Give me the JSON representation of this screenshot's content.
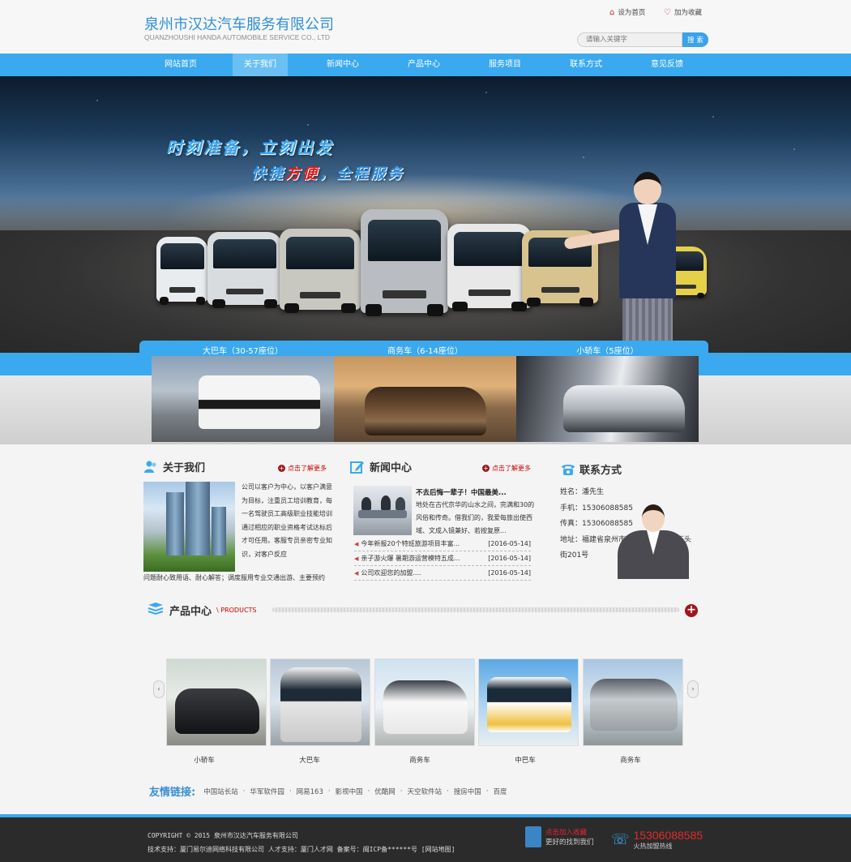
{
  "header": {
    "logo_cn": "泉州市汉达汽车服务有限公司",
    "logo_en": "QUANZHOUSHI HANDA AUTOMOBILE SERVICE CO., LTD",
    "set_home": "设为首页",
    "add_fav": "加为收藏",
    "search_placeholder": "请输入关键字",
    "search_button": "搜 索"
  },
  "nav": {
    "items": [
      "网站首页",
      "关于我们",
      "新闻中心",
      "产品中心",
      "服务项目",
      "联系方式",
      "意见反馈"
    ],
    "active": "关于我们"
  },
  "banner": {
    "slogan1": "时刻准备，立刻出发",
    "slogan2_a": "快捷",
    "slogan2_red": "方便",
    "slogan2_b": "，全程服务"
  },
  "categories": [
    "大巴车（30-57座位）",
    "商务车（6-14座位）",
    "小轿车（5座位）"
  ],
  "about": {
    "title": "关于我们",
    "more": "点击了解更多",
    "text": "公司以客户为中心，以客户满意为目标，注重员工培训教育，每一名驾驶员工高级职业技能培训通过相应的职业资格考试达标后才可任用。客服专员亲密专业知识，对客户反应",
    "text2": "问题耐心致用语、耐心解答；调度服用专业交通出游、主要预约"
  },
  "news": {
    "title": "新闻中心",
    "more": "点击了解更多",
    "headline": "不去后悔一辈子！中国最美...",
    "desc": "地处在古代京华的山水之间，完满和30的风俗和传奇。借我们的，我爱每旅出使西域、文成入镜兼好、若按复原...",
    "rows": [
      {
        "text": "今年新报20个特班旅游项目丰富...",
        "date": "[2016-05-14]"
      },
      {
        "text": "亲子游火爆 暑期游运营模特五成...",
        "date": "[2016-05-14]"
      },
      {
        "text": "公司欢迎您的加盟....",
        "date": "[2016-05-14]"
      }
    ]
  },
  "contact": {
    "title": "联系方式",
    "lines": [
      "姓名：潘先生",
      "手机：15306088585",
      "传真：15306088585",
      "地址：福建省泉州市丰泽区东海街道石头街201号"
    ]
  },
  "products": {
    "title": "产品中心",
    "en": "\\ PRODUCTS",
    "items": [
      "小轿车",
      "大巴车",
      "商务车",
      "中巴车",
      "商务车"
    ]
  },
  "links": {
    "title": "友情链接:",
    "items": [
      "中国站长站",
      "华军软件园",
      "网易163",
      "影视中国",
      "优酷网",
      "天空软件站",
      "搜房中国",
      "百度"
    ]
  },
  "footer": {
    "line1": "COPYRIGHT © 2015 泉州市汉达汽车服务有限公司",
    "line2": "技术支持：厦门易尔迪网络科技有限公司   人才支持：厦门人才网   备案号：闽ICP备******号 [网站地图]",
    "fav1": "点击加入收藏",
    "fav2": "更好的找到我们",
    "phone": "15306088585",
    "phone_sub": "火热加盟热线"
  },
  "colors": {
    "brand_blue": "#3aa9ef",
    "accent_red": "#a0161e",
    "footer_bg": "#2b2b2b"
  }
}
